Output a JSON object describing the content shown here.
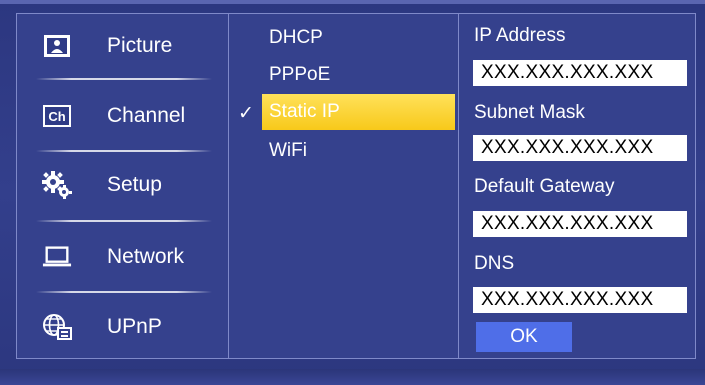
{
  "menu": {
    "items": [
      {
        "label": "Picture",
        "icon": "picture-icon"
      },
      {
        "label": "Channel",
        "icon": "channel-icon",
        "icon_text": "Ch"
      },
      {
        "label": "Setup",
        "icon": "gears-icon"
      },
      {
        "label": "Network",
        "icon": "laptop-icon"
      },
      {
        "label": "UPnP",
        "icon": "globe-icon"
      }
    ]
  },
  "network_modes": {
    "options": [
      "DHCP",
      "PPPoE",
      "Static IP",
      "WiFi"
    ],
    "selected": "Static IP",
    "check_mark": "✓"
  },
  "static_ip": {
    "ip_label": "IP Address",
    "ip_value": "XXX.XXX.XXX.XXX",
    "subnet_label": "Subnet Mask",
    "subnet_value": "XXX.XXX.XXX.XXX",
    "gateway_label": "Default Gateway",
    "gateway_value": "XXX.XXX.XXX.XXX",
    "dns_label": "DNS",
    "dns_value": "XXX.XXX.XXX.XXX",
    "ok_label": "OK"
  },
  "colors": {
    "background": "#303b86",
    "selection": "#f7c91a",
    "ok_button": "#4f6ee8"
  }
}
